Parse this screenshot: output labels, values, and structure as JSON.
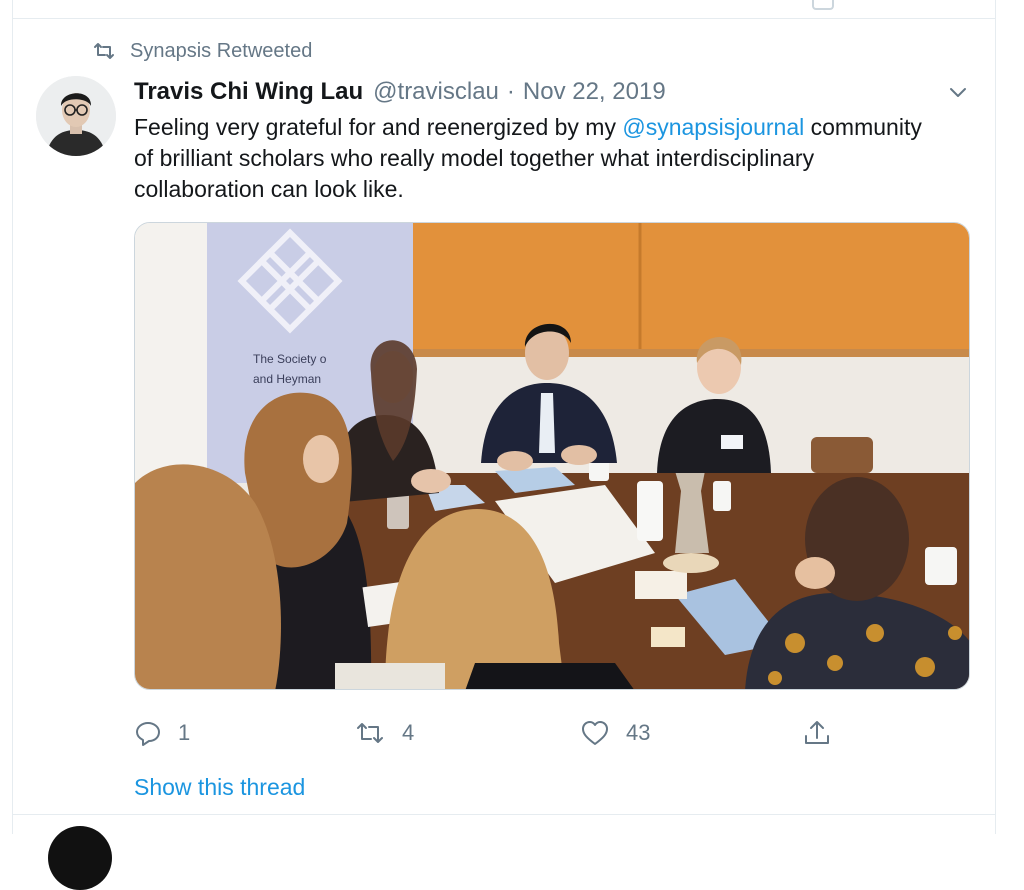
{
  "tweet": {
    "retweet_label": "Synapsis Retweeted",
    "author_name": "Travis Chi Wing Lau",
    "author_handle": "@travisclau",
    "separator": "·",
    "date": "Nov 22, 2019",
    "text_before": "Feeling very grateful for and reenergized by my ",
    "mention": "@synapsisjournal",
    "text_after": " community of brilliant scholars who really model together what interdisciplinary collaboration can look like.",
    "banner_text_line1": "The Society o",
    "banner_text_line2": "and Heyman",
    "reply_count": "1",
    "retweet_count": "4",
    "like_count": "43",
    "show_thread_label": "Show this thread"
  },
  "icons": {
    "retweet": "retweet-icon",
    "reply": "reply-icon",
    "like": "heart-icon",
    "share": "share-icon",
    "menu": "chevron-down-icon"
  },
  "colors": {
    "link": "#1b95e0",
    "muted": "#657786",
    "text": "#14171a",
    "border": "#e6ecf0"
  }
}
